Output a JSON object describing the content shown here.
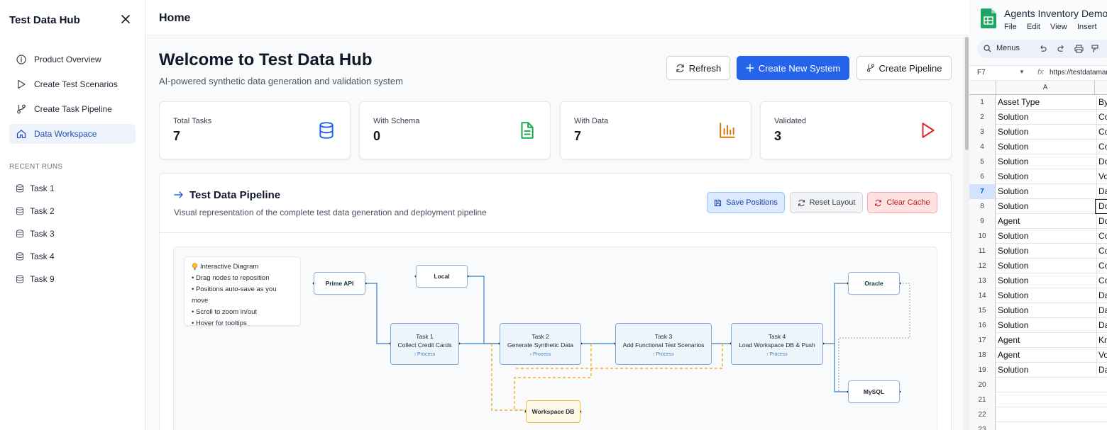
{
  "sidebar": {
    "title": "Test Data Hub",
    "nav": [
      {
        "label": "Product Overview",
        "icon": "info-icon"
      },
      {
        "label": "Create Test Scenarios",
        "icon": "play-icon"
      },
      {
        "label": "Create Task Pipeline",
        "icon": "git-branch-icon"
      },
      {
        "label": "Data Workspace",
        "icon": "home-icon",
        "active": true
      }
    ],
    "recent_runs_label": "RECENT RUNS",
    "runs": [
      "Task 1",
      "Task 2",
      "Task 3",
      "Task 4",
      "Task 9"
    ]
  },
  "topbar": {
    "title": "Home"
  },
  "main": {
    "heading": "Welcome to Test Data Hub",
    "subtitle": "AI-powered synthetic data generation and validation system",
    "buttons": {
      "refresh": "Refresh",
      "create_system": "Create New System",
      "create_pipeline": "Create Pipeline"
    },
    "stats": [
      {
        "label": "Total Tasks",
        "value": "7",
        "icon": "database-icon",
        "color": "#2563eb"
      },
      {
        "label": "With Schema",
        "value": "0",
        "icon": "file-text-icon",
        "color": "#16a34a"
      },
      {
        "label": "With Data",
        "value": "7",
        "icon": "bar-chart-icon",
        "color": "#d97706"
      },
      {
        "label": "Validated",
        "value": "3",
        "icon": "play-icon",
        "color": "#dc2626"
      }
    ]
  },
  "pipeline": {
    "title": "Test Data Pipeline",
    "subtitle": "Visual representation of the complete test data generation and deployment pipeline",
    "buttons": {
      "save": "Save Positions",
      "reset": "Reset Layout",
      "clear": "Clear Cache"
    },
    "legend": {
      "title": "Interactive Diagram",
      "items": [
        "• Drag nodes to reposition",
        "• Positions auto-save as you move",
        "• Scroll to zoom in/out",
        "• Hover for tooltips"
      ]
    },
    "nodes": {
      "prime_api": "Prime API",
      "local": "Local",
      "oracle": "Oracle",
      "mysql": "MySQL",
      "workspace_db": "Workspace DB",
      "task1": {
        "title": "Task 1",
        "name": "Collect Credit Cards",
        "action": "› Process"
      },
      "task2": {
        "title": "Task 2",
        "name": "Generate Synthetic Data",
        "action": "› Process"
      },
      "task3": {
        "title": "Task 3",
        "name": "Add Functional Test Scenarios",
        "action": "› Process"
      },
      "task4": {
        "title": "Task 4",
        "name": "Load Workspace DB & Push",
        "action": "› Process"
      }
    }
  },
  "sheet": {
    "title": "Agents Inventory Demo",
    "menu": [
      "File",
      "Edit",
      "View",
      "Insert"
    ],
    "search": "Menus",
    "cell_ref": "F7",
    "formula": "https://testdatamanager",
    "col_a": "A",
    "rows": [
      {
        "n": "1",
        "a": "Asset Type",
        "b": "By"
      },
      {
        "n": "2",
        "a": "Solution",
        "b": "Co"
      },
      {
        "n": "3",
        "a": "Solution",
        "b": "Co"
      },
      {
        "n": "4",
        "a": "Solution",
        "b": "Co"
      },
      {
        "n": "5",
        "a": "Solution",
        "b": "Do"
      },
      {
        "n": "6",
        "a": "Solution",
        "b": "Vo"
      },
      {
        "n": "7",
        "a": "Solution",
        "b": "Da"
      },
      {
        "n": "8",
        "a": "Solution",
        "b": "Do"
      },
      {
        "n": "9",
        "a": "Agent",
        "b": "Do"
      },
      {
        "n": "10",
        "a": "Solution",
        "b": "Co"
      },
      {
        "n": "11",
        "a": "Solution",
        "b": "Co"
      },
      {
        "n": "12",
        "a": "Solution",
        "b": "Co"
      },
      {
        "n": "13",
        "a": "Solution",
        "b": "Co"
      },
      {
        "n": "14",
        "a": "Solution",
        "b": "Da"
      },
      {
        "n": "15",
        "a": "Solution",
        "b": "Da"
      },
      {
        "n": "16",
        "a": "Solution",
        "b": "Da"
      },
      {
        "n": "17",
        "a": "Agent",
        "b": "Kn"
      },
      {
        "n": "18",
        "a": "Agent",
        "b": "Vo"
      },
      {
        "n": "19",
        "a": "Solution",
        "b": "Da"
      },
      {
        "n": "20",
        "a": "",
        "b": ""
      },
      {
        "n": "21",
        "a": "",
        "b": ""
      },
      {
        "n": "22",
        "a": "",
        "b": ""
      },
      {
        "n": "23",
        "a": "",
        "b": ""
      }
    ]
  }
}
